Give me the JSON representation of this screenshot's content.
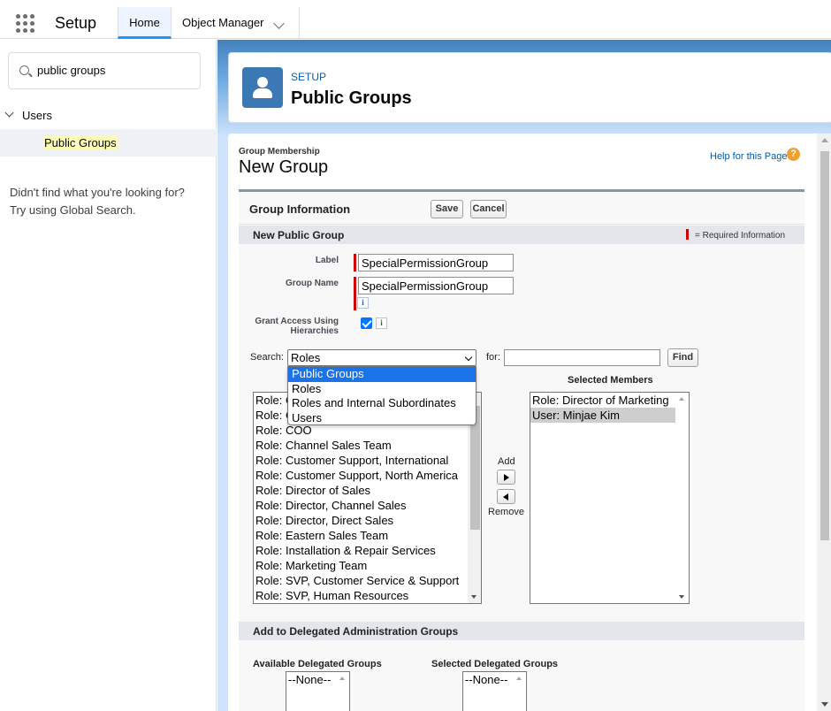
{
  "topbar": {
    "app_name": "Setup",
    "nav": {
      "home": "Home",
      "object_manager": "Object Manager"
    }
  },
  "sidebar": {
    "quickfind_value": "public groups",
    "tree": {
      "parent": "Users",
      "child": "Public Groups"
    },
    "not_found_line1": "Didn't find what you're looking for?",
    "not_found_line2": "Try using Global Search."
  },
  "header": {
    "breadcrumb": "SETUP",
    "title": "Public Groups"
  },
  "page": {
    "group_membership_label": "Group Membership",
    "title": "New Group",
    "help_link": "Help for this Page",
    "help_icon": "?"
  },
  "block": {
    "title": "Group Information",
    "save": "Save",
    "cancel": "Cancel",
    "section_new": "New Public Group",
    "required_info": "= Required Information",
    "label_label": "Label",
    "label_value": "SpecialPermissionGroup",
    "group_name_label": "Group Name",
    "group_name_value": "SpecialPermissionGroup",
    "grant_access_label_1": "Grant Access Using",
    "grant_access_label_2": "Hierarchies",
    "info_glyph": "i",
    "search_label": "Search:",
    "search_selected": "Roles",
    "for_label": "for:",
    "for_value": "",
    "find": "Find",
    "search_options": [
      "Public Groups",
      "Roles",
      "Roles and Internal Subordinates",
      "Users"
    ],
    "available_members": [
      "Role: CEO",
      "Role: CFO",
      "Role: COO",
      "Role: Channel Sales Team",
      "Role: Customer Support, International",
      "Role: Customer Support, North America",
      "Role: Director of Sales",
      "Role: Director, Channel Sales",
      "Role: Director, Direct Sales",
      "Role: Eastern Sales Team",
      "Role: Installation & Repair Services",
      "Role: Marketing Team",
      "Role: SVP, Customer Service & Support",
      "Role: SVP, Human Resources"
    ],
    "selected_members_label": "Selected Members",
    "selected_members": [
      "Role: Director of Marketing",
      "User: Minjae Kim"
    ],
    "add": "Add",
    "remove": "Remove",
    "section_delegated": "Add to Delegated Administration Groups",
    "available_delegated_label": "Available Delegated Groups",
    "available_delegated": [
      "--None--"
    ],
    "selected_delegated_label": "Selected Delegated Groups",
    "selected_delegated": [
      "--None--"
    ]
  },
  "colors": {
    "accent": "#1b96ff",
    "header_icon": "#3c79b4",
    "required": "#cc0000",
    "dropdown_highlight": "#1a73e8"
  }
}
